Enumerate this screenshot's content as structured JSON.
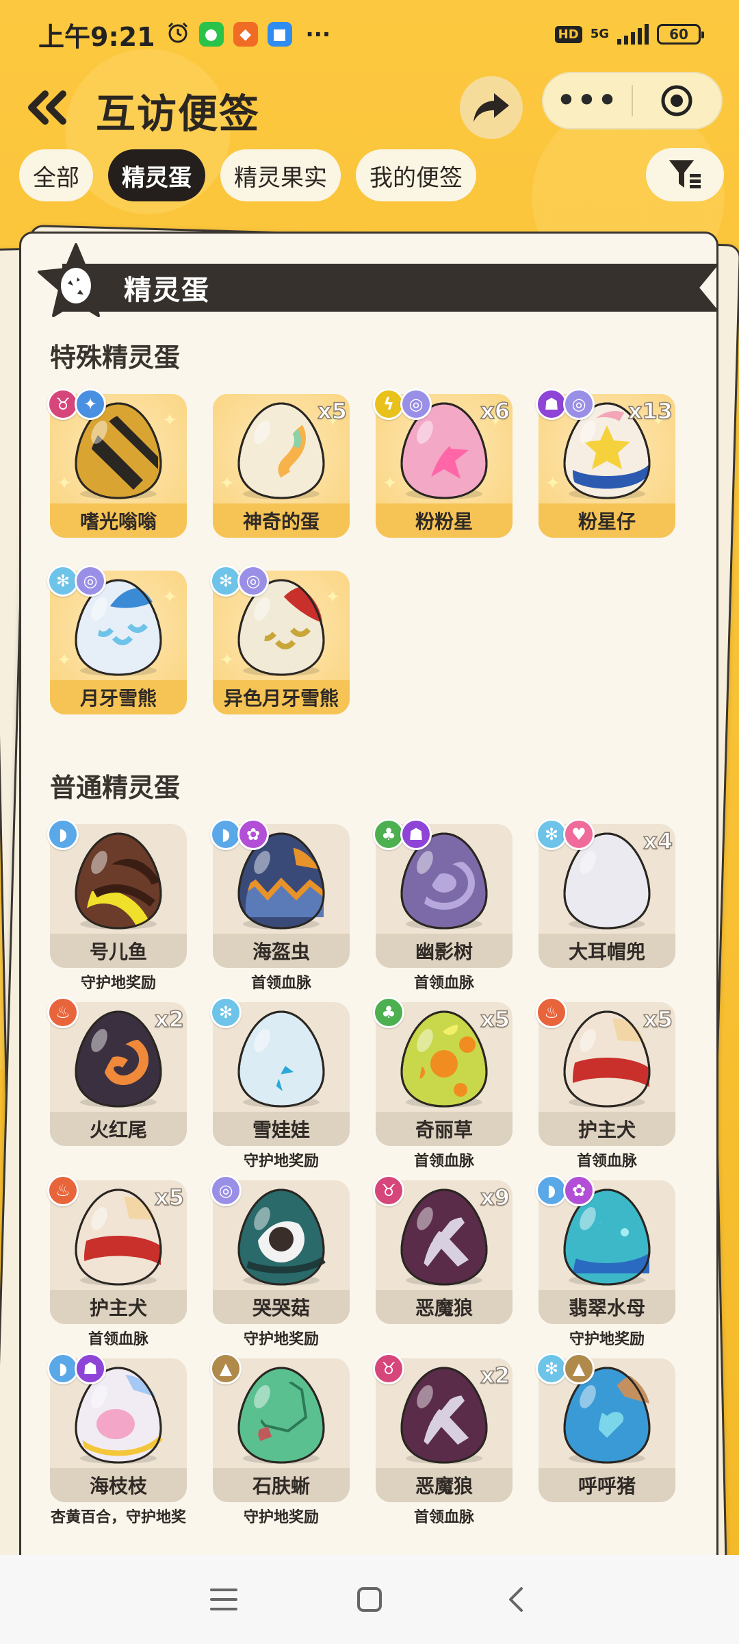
{
  "status": {
    "time": "上午9:21",
    "net": "5G",
    "battery": "60",
    "hd": "HD",
    "more": "···"
  },
  "header": {
    "title": "互访便签",
    "back_label": "«",
    "more_label": "•••"
  },
  "tabs": [
    {
      "label": "全部",
      "active": false
    },
    {
      "label": "精灵蛋",
      "active": true
    },
    {
      "label": "精灵果实",
      "active": false
    },
    {
      "label": "我的便签",
      "active": false
    }
  ],
  "section": {
    "title": "精灵蛋"
  },
  "special": {
    "heading": "特殊精灵蛋",
    "eggs": [
      {
        "name": "嗜光嗡嗡",
        "count": "",
        "tags": [
          "demon",
          "light"
        ]
      },
      {
        "name": "神奇的蛋",
        "count": "x5",
        "tags": []
      },
      {
        "name": "粉粉星",
        "count": "x6",
        "tags": [
          "electric",
          "illusion"
        ]
      },
      {
        "name": "粉星仔",
        "count": "x13",
        "tags": [
          "ghost",
          "illusion"
        ]
      },
      {
        "name": "月牙雪熊",
        "count": "",
        "tags": [
          "ice",
          "illusion"
        ]
      },
      {
        "name": "异色月牙雪熊",
        "count": "",
        "tags": [
          "ice",
          "illusion"
        ]
      }
    ]
  },
  "normal": {
    "heading": "普通精灵蛋",
    "eggs": [
      {
        "name": "号儿鱼",
        "count": "",
        "tags": [
          "water"
        ],
        "sub": "守护地奖励"
      },
      {
        "name": "海盔虫",
        "count": "",
        "tags": [
          "water",
          "bug"
        ],
        "sub": "首领血脉"
      },
      {
        "name": "幽影树",
        "count": "",
        "tags": [
          "grass",
          "ghost"
        ],
        "sub": "首领血脉"
      },
      {
        "name": "大耳帽兜",
        "count": "x4",
        "tags": [
          "ice",
          "heart"
        ],
        "sub": ""
      },
      {
        "name": "火红尾",
        "count": "x2",
        "tags": [
          "fire"
        ],
        "sub": ""
      },
      {
        "name": "雪娃娃",
        "count": "",
        "tags": [
          "ice"
        ],
        "sub": "守护地奖励"
      },
      {
        "name": "奇丽草",
        "count": "x5",
        "tags": [
          "grass"
        ],
        "sub": "首领血脉"
      },
      {
        "name": "护主犬",
        "count": "x5",
        "tags": [
          "fire"
        ],
        "sub": "首领血脉"
      },
      {
        "name": "护主犬",
        "count": "x5",
        "tags": [
          "fire"
        ],
        "sub": "首领血脉"
      },
      {
        "name": "哭哭菇",
        "count": "",
        "tags": [
          "illusion"
        ],
        "sub": "守护地奖励"
      },
      {
        "name": "恶魔狼",
        "count": "x9",
        "tags": [
          "demon"
        ],
        "sub": ""
      },
      {
        "name": "翡翠水母",
        "count": "",
        "tags": [
          "water",
          "bug"
        ],
        "sub": "守护地奖励"
      },
      {
        "name": "海枝枝",
        "count": "",
        "tags": [
          "water",
          "ghost"
        ],
        "sub": "杏黄百合，守护地奖"
      },
      {
        "name": "石肤蜥",
        "count": "",
        "tags": [
          "ground"
        ],
        "sub": "守护地奖励"
      },
      {
        "name": "恶魔狼",
        "count": "x2",
        "tags": [
          "demon"
        ],
        "sub": "首领血脉"
      },
      {
        "name": "呼呼猪",
        "count": "",
        "tags": [
          "ice",
          "ground"
        ],
        "sub": ""
      }
    ]
  },
  "colors": {
    "accent": "#f7c23a",
    "dark": "#241f1c",
    "water": "#5aa8e8",
    "fire": "#e8643a",
    "grass": "#4caf50",
    "ice": "#6ec3e8",
    "ghost": "#8e44d6",
    "demon": "#d6467a",
    "illusion": "#9a8fe6",
    "electric": "#e8c21a",
    "bug": "#b24fd6",
    "heart": "#f06a9a",
    "ground": "#b08a4a",
    "light": "#4a90e2"
  },
  "icons": {
    "back": "double-chevron-left-icon",
    "share": "share-arrow-icon",
    "more": "more-dots-icon",
    "target": "target-icon",
    "filter": "filter-icon",
    "nav_menu": "menu-icon",
    "nav_home": "home-square-icon",
    "nav_back": "back-chevron-icon"
  }
}
